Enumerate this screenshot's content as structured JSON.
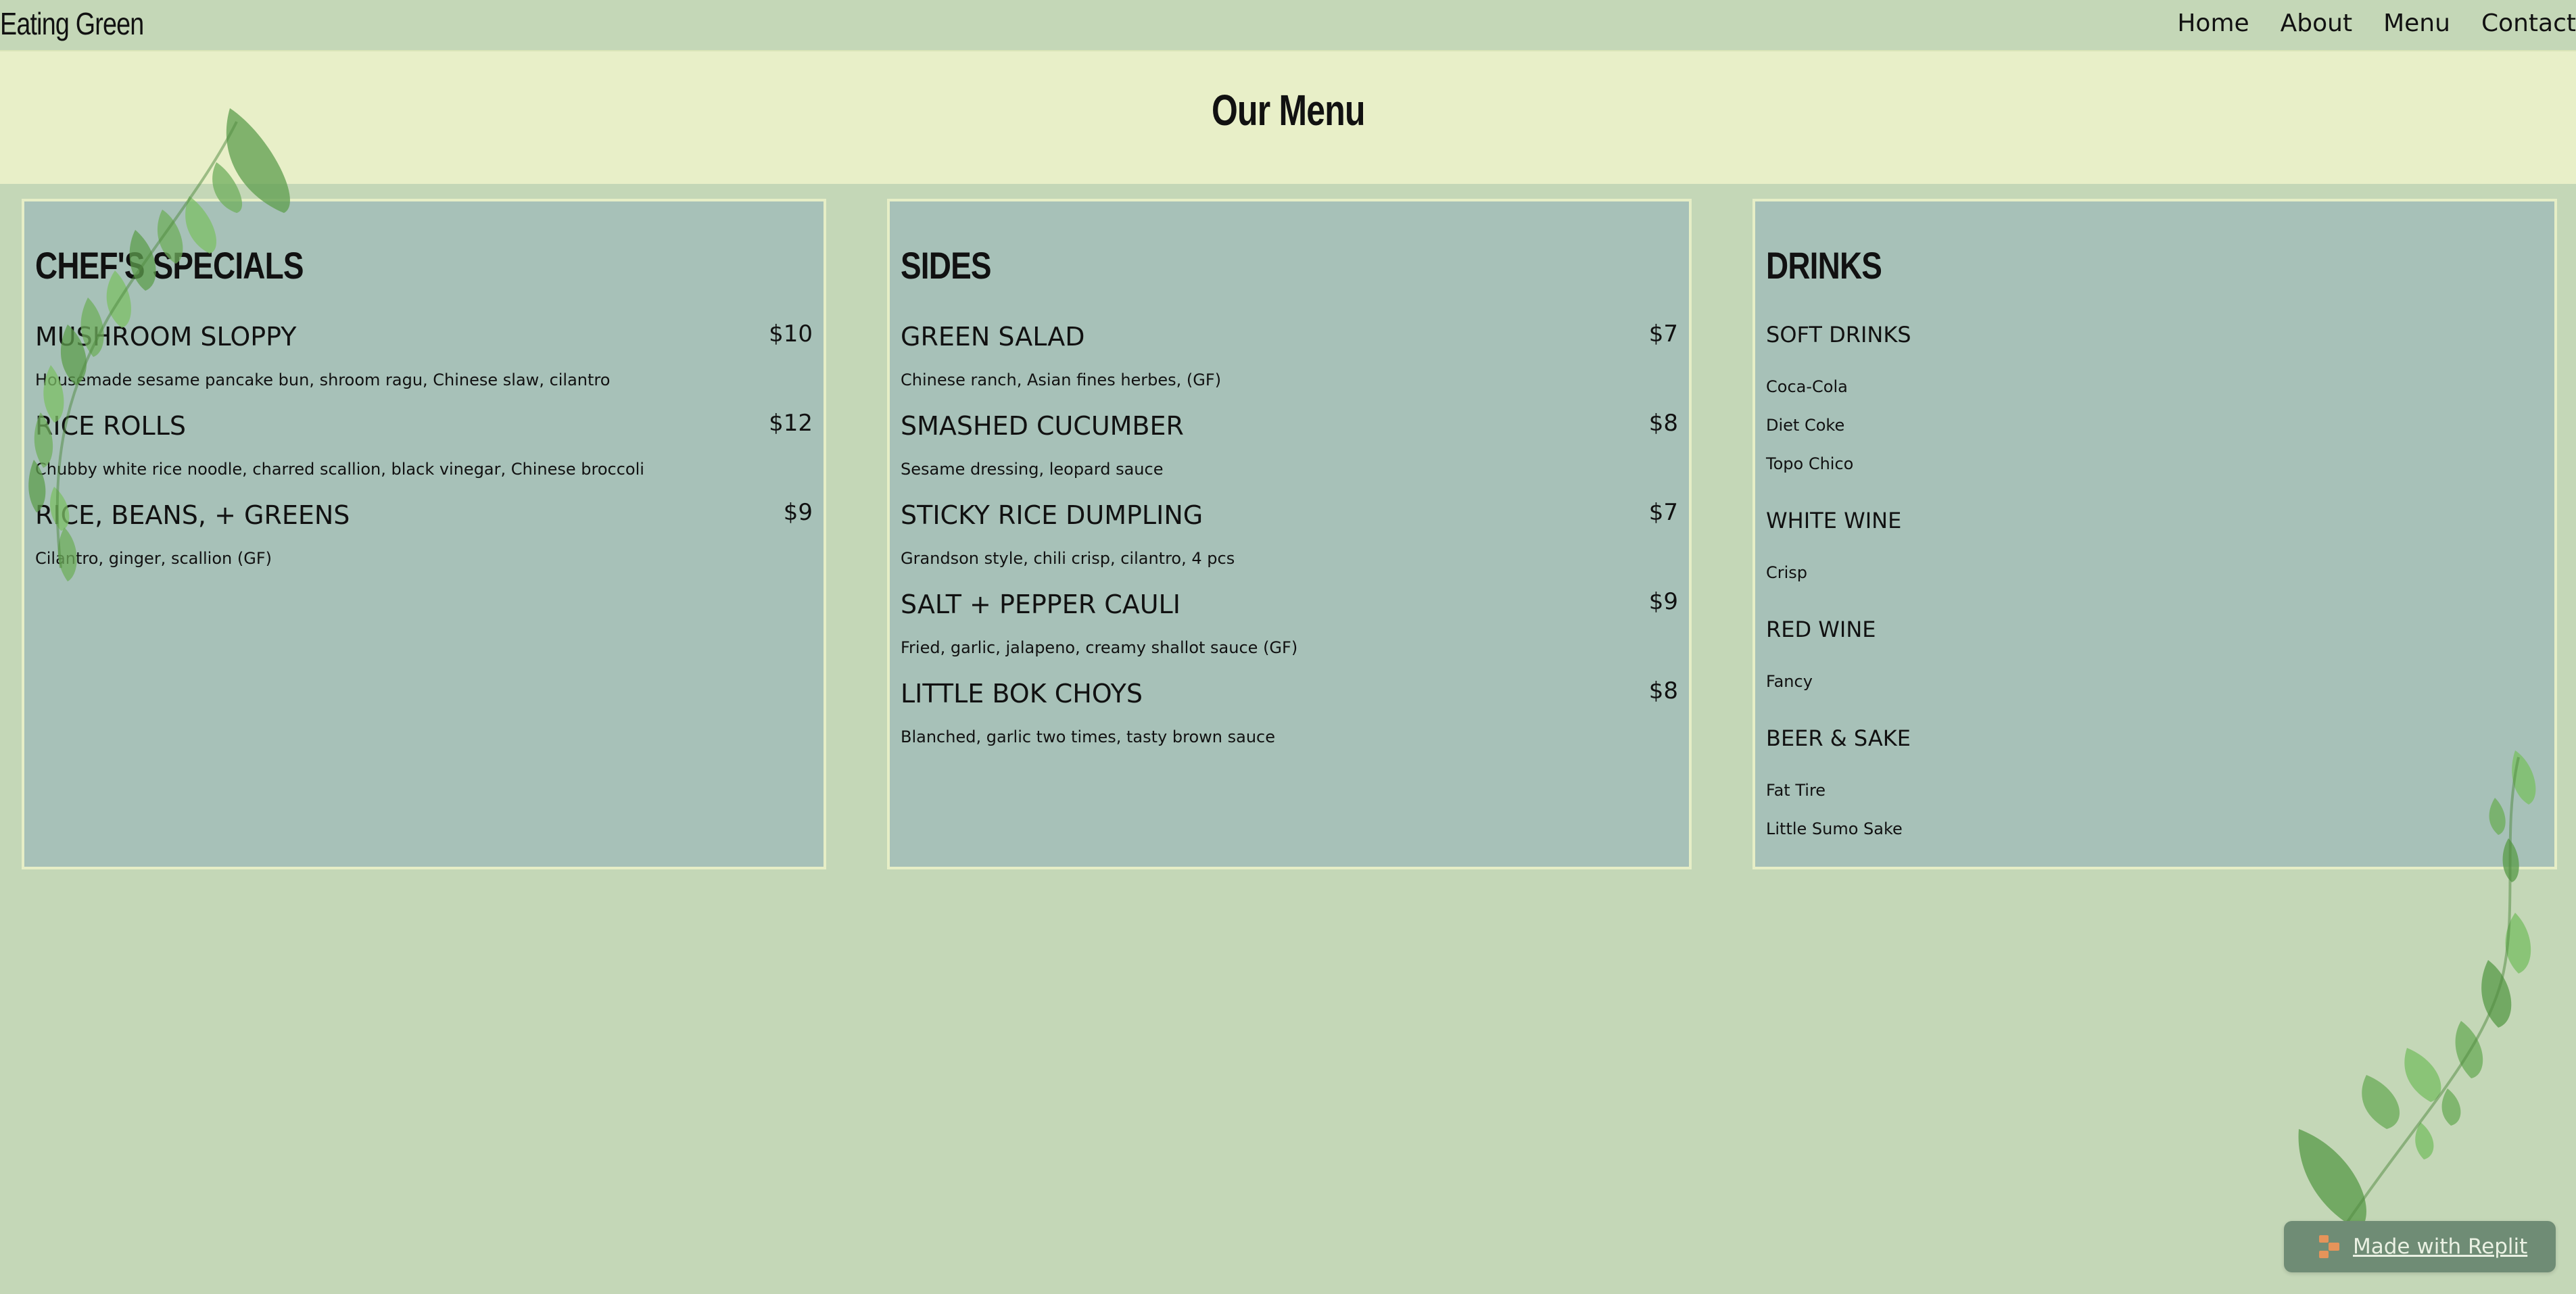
{
  "site": {
    "brand": "Eating Green",
    "nav": [
      "Home",
      "About",
      "Menu",
      "Contact"
    ]
  },
  "header": {
    "title": "Our Menu"
  },
  "specials": {
    "title": "CHEF'S SPECIALS",
    "items": [
      {
        "name": "MUSHROOM SLOPPY",
        "price": "$10",
        "desc": "Housemade sesame pancake bun, shroom ragu, Chinese slaw, cilantro"
      },
      {
        "name": "RICE ROLLS",
        "price": "$12",
        "desc": "Chubby white rice noodle, charred scallion, black vinegar, Chinese broccoli"
      },
      {
        "name": "RICE, BEANS, + GREENS",
        "price": "$9",
        "desc": "Cilantro, ginger, scallion (GF)"
      }
    ]
  },
  "sides": {
    "title": "SIDES",
    "items": [
      {
        "name": "GREEN SALAD",
        "price": "$7",
        "desc": "Chinese ranch, Asian fines herbes, (GF)"
      },
      {
        "name": "SMASHED CUCUMBER",
        "price": "$8",
        "desc": "Sesame dressing, leopard sauce"
      },
      {
        "name": "STICKY RICE DUMPLING",
        "price": "$7",
        "desc": "Grandson style, chili crisp, cilantro, 4 pcs"
      },
      {
        "name": "SALT + PEPPER CAULI",
        "price": "$9",
        "desc": "Fried, garlic, jalapeno, creamy shallot sauce (GF)"
      },
      {
        "name": "LITTLE BOK CHOYS",
        "price": "$8",
        "desc": "Blanched, garlic two times, tasty brown sauce"
      }
    ]
  },
  "drinks": {
    "title": "DRINKS",
    "categories": [
      {
        "name": "SOFT DRINKS",
        "items": [
          "Coca-Cola",
          "Diet Coke",
          "Topo Chico"
        ]
      },
      {
        "name": "WHITE WINE",
        "items": [
          "Crisp"
        ]
      },
      {
        "name": "RED WINE",
        "items": [
          "Fancy"
        ]
      },
      {
        "name": "BEER & SAKE",
        "items": [
          "Fat Tire",
          "Little Sumo Sake"
        ]
      }
    ]
  },
  "badge": {
    "label": "Made with Replit",
    "icon": "replit-icon"
  },
  "colors": {
    "page_bg": "#c4d7b7",
    "header_band": "#e8efc8",
    "card_bg": "#a7c1b8",
    "card_border": "#e6eec6",
    "badge_bg": "#6f8c75"
  }
}
